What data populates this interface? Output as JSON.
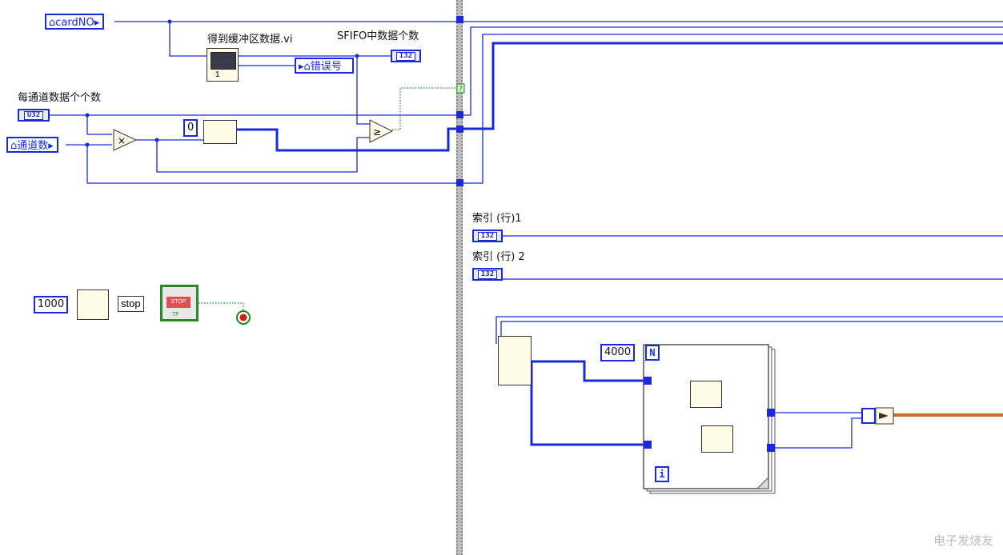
{
  "controls": {
    "cardno": "cardNO",
    "channels": "通道数",
    "per_channel_count": "U32",
    "error_no": "错误号"
  },
  "labels": {
    "get_buffer_vi": "得到缓冲区数据.vi",
    "sfifo_count": "SFIFO中数据个数",
    "per_channel_title": "每通道数据个个数",
    "index_row1": "索引 (行)1",
    "index_row2": "索引 (行) 2",
    "stop_label": "stop"
  },
  "indicators": {
    "sfifo": "I32",
    "index1": "I32",
    "index2": "I32"
  },
  "constants": {
    "zero": "0",
    "wait_ms": "1000",
    "loop_count": "4000",
    "loop_n": "N",
    "loop_i": "i",
    "subvi_terminal": "1"
  },
  "nodes": {
    "multiply": "×",
    "compare": "≥",
    "stop_button": "STOP",
    "tf": "TF",
    "qmark": "?"
  },
  "watermark": "电子发烧友"
}
